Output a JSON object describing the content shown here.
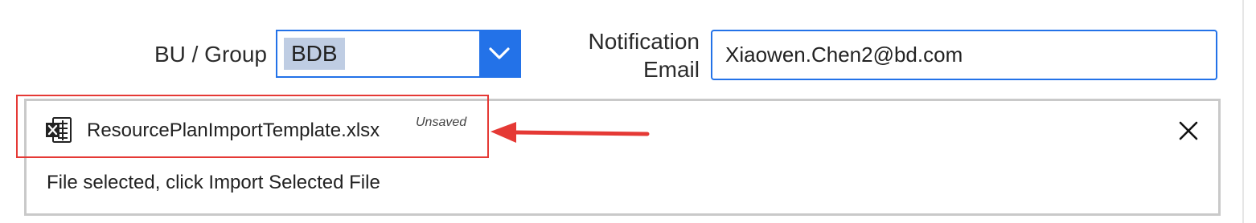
{
  "form": {
    "bu_group_label": "BU / Group",
    "bu_group_value": "BDB",
    "notification_label_line1": "Notification",
    "notification_label_line2": "Email",
    "notification_email_value": "Xiaowen.Chen2@bd.com"
  },
  "file_panel": {
    "file_name": "ResourcePlanImportTemplate.xlsx",
    "unsaved_label": "Unsaved",
    "status_text": "File selected, click Import Selected File",
    "file_icon": "excel-file-icon",
    "close_icon": "close-icon"
  },
  "annotation": {
    "highlight_color": "#e53935",
    "arrow_color": "#e53935"
  },
  "colors": {
    "accent": "#2372e8",
    "selected_highlight": "#bfcde3",
    "panel_border": "#c9c9c9"
  }
}
